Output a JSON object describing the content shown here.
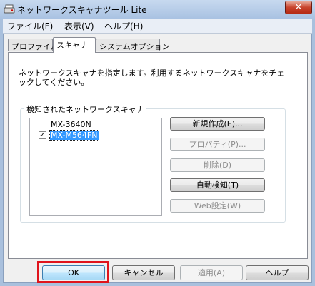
{
  "window": {
    "title": "ネットワークスキャナツール Lite",
    "close_label": "✕"
  },
  "menu": [
    {
      "label": "ファイル(F)"
    },
    {
      "label": "表示(V)"
    },
    {
      "label": "ヘルプ(H)"
    }
  ],
  "tabs": [
    {
      "label": "プロファイル"
    },
    {
      "label": "スキャナ"
    },
    {
      "label": "システムオプション"
    }
  ],
  "scanner_tab": {
    "description": "ネットワークスキャナを指定します。利用するネットワークスキャナをチェックしてください。",
    "group_label": "検知されたネットワークスキャナ",
    "scanners": [
      {
        "name": "MX-3640N",
        "checked": false,
        "selected": false
      },
      {
        "name": "MX-M564FN",
        "checked": true,
        "selected": true
      }
    ],
    "buttons": {
      "new": "新規作成(E)...",
      "properties": "プロパティ(P)...",
      "delete": "削除(D)",
      "auto_detect": "自動検知(T)",
      "web_settings": "Web設定(W)"
    }
  },
  "footer": {
    "ok": "OK",
    "cancel": "キャンセル",
    "apply": "適用(A)",
    "help": "ヘルプ"
  },
  "highlight_color": "#e0141c"
}
